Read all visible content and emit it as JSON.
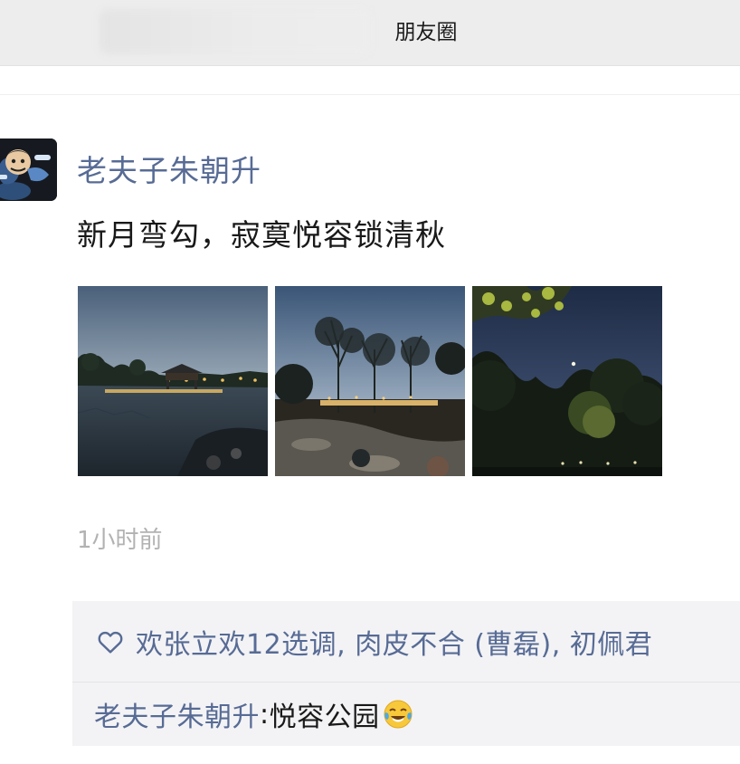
{
  "header": {
    "title": "朋友圈"
  },
  "post": {
    "author": "老夫子朱朝升",
    "text": "新月弯勾，寂寞悦容锁清秋",
    "photos": [
      "lakeside-pavilion-dusk",
      "park-trees-dusk",
      "moon-over-trees-night"
    ],
    "time": "1小时前"
  },
  "likes": {
    "icon": "heart-outline-icon",
    "names": "欢张立欢12选调, 肉皮不合 (曹磊), 初佩君"
  },
  "comments": [
    {
      "author": "老夫子朱朝升",
      "separator": ": ",
      "text": "悦容公园",
      "emoji": "crying-laughing-emoji"
    }
  ],
  "colors": {
    "link": "#576b95",
    "header_bg": "#ededed",
    "interact_bg": "#f3f3f5",
    "time": "#b2b2b2"
  }
}
